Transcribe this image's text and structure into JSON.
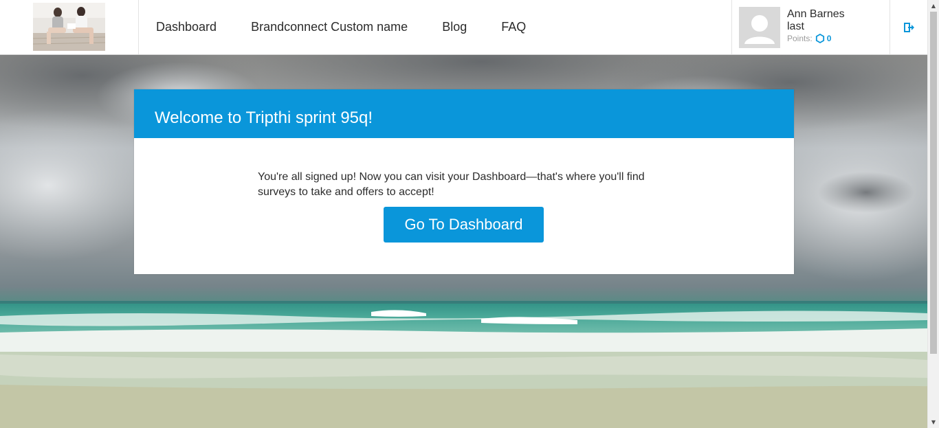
{
  "header": {
    "logo_alt": "brand logo photo",
    "nav": [
      {
        "label": "Dashboard"
      },
      {
        "label": "Brandconnect Custom name"
      },
      {
        "label": "Blog"
      },
      {
        "label": "FAQ"
      }
    ],
    "profile": {
      "name": "Ann Barnes",
      "last": "last",
      "points_label": "Points:",
      "points_value": "0",
      "icon": "avatar-placeholder-icon"
    },
    "logout_icon": "logout-icon"
  },
  "card": {
    "title": "Welcome to Tripthi sprint 95q!",
    "message": "You're all signed up! Now you can visit your Dashboard—that's where you'll find surveys to take and offers to accept!",
    "button_label": "Go To Dashboard"
  },
  "colors": {
    "accent": "#0a96da",
    "header_bg": "#ffffff",
    "text": "#2b2b2b"
  }
}
